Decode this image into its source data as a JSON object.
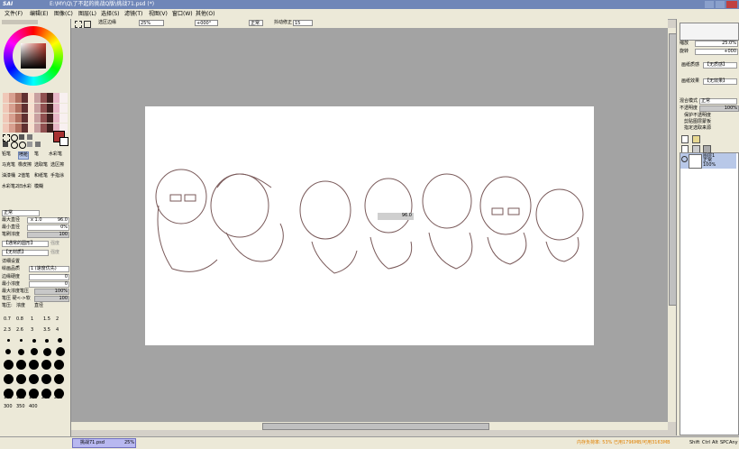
{
  "window": {
    "app_logo": "SAI",
    "title": "E:\\MY\\Q\\了不起的挑战Q版\\挑战71.psd (*)"
  },
  "menu": [
    "文件(F)",
    "编辑(E)",
    "图像(C)",
    "图层(L)",
    "选择(S)",
    "滤镜(T)",
    "视图(V)",
    "窗口(W)",
    "其他(O)"
  ],
  "toolbar": {
    "checkbox_label": "选区边缘",
    "zoom": "25%",
    "angle": "+000°",
    "blend": "正常",
    "stabilizer_label": "抖动修正",
    "stabilizer_value": "15"
  },
  "colors": {
    "primary": "#a83232",
    "accent": "#6f86b8",
    "canvas_bg": "#a3a3a3"
  },
  "left_panel": {
    "tools": [
      {
        "label": "铅笔"
      },
      {
        "label": "喷枪"
      },
      {
        "label": "笔"
      },
      {
        "label": "水彩笔"
      },
      {
        "label": "马克笔"
      },
      {
        "label": "橡皮擦"
      },
      {
        "label": "选取笔"
      },
      {
        "label": "选区擦"
      },
      {
        "label": "油漆桶"
      },
      {
        "label": "2值笔"
      },
      {
        "label": "和纸笔"
      },
      {
        "label": "手指涂"
      },
      {
        "label": "水彩笔2"
      },
      {
        "label": "旧水彩"
      },
      {
        "label": "模糊"
      },
      {
        "label": ""
      }
    ],
    "blend_mode": "正常",
    "max_diameter_label": "最大直径",
    "max_diameter_mult": "x 1.0",
    "max_diameter_value": "96.0",
    "min_diameter_label": "最小直径",
    "min_diameter_value": "0%",
    "density_label": "笔刷浓度",
    "density_value": "100",
    "brush_shape": "【通常的圆形】",
    "brush_texture": "【无材质】",
    "strength_label": "强度",
    "detail_label": "详细设置",
    "quality_label": "绘画品质",
    "quality_value": "1 (速度优先)",
    "edge_hardness_label": "边缘硬度",
    "edge_hardness_value": "0",
    "min_density_label": "最小浓度",
    "min_density_value": "0",
    "max_pressure_label": "最大浓度笔压",
    "max_pressure_value": "100%",
    "pressure_label": "笔压 硬<->软",
    "pressure_value": "100",
    "pressure_opts": "笔压:",
    "density_opt": "浓度",
    "diameter_opt": "直径",
    "preset_sizes": [
      "0.7",
      "0.8",
      "1",
      "1.5",
      "2",
      "2.3",
      "2.6",
      "3",
      "3.5",
      "4"
    ],
    "big_sizes": [
      "100",
      "120",
      "160",
      "200",
      "250",
      "300",
      "350",
      "400",
      "450",
      "500"
    ]
  },
  "right_panel": {
    "zoom_label": "缩放",
    "zoom_value": "25.0%",
    "rotate_label": "旋转",
    "rotate_value": "+000",
    "paper_texture_label": "画纸质感",
    "paper_texture_value": "【无质感】",
    "paper_effect_label": "画纸效果",
    "paper_effect_value": "【无效果】",
    "blend_label": "混合模式",
    "blend_value": "正常",
    "opacity_label": "不透明度",
    "opacity_value": "100%",
    "opt1": "保护不透明度",
    "opt2": "剪贴图层蒙板",
    "opt3": "指定选取来源",
    "layer_name": "图层1",
    "layer_mode": "正常",
    "layer_opacity": "100%"
  },
  "overlay": {
    "brush_size_hud": "96.0"
  },
  "status": {
    "tab_name": "挑战71.psd",
    "tab_zoom": "25%",
    "memory": "内存负荷率: 53%  已用1796MB/可用3163MB",
    "keys": [
      "Shift",
      "Ctrl",
      "Alt",
      "SPC",
      "Any"
    ]
  }
}
